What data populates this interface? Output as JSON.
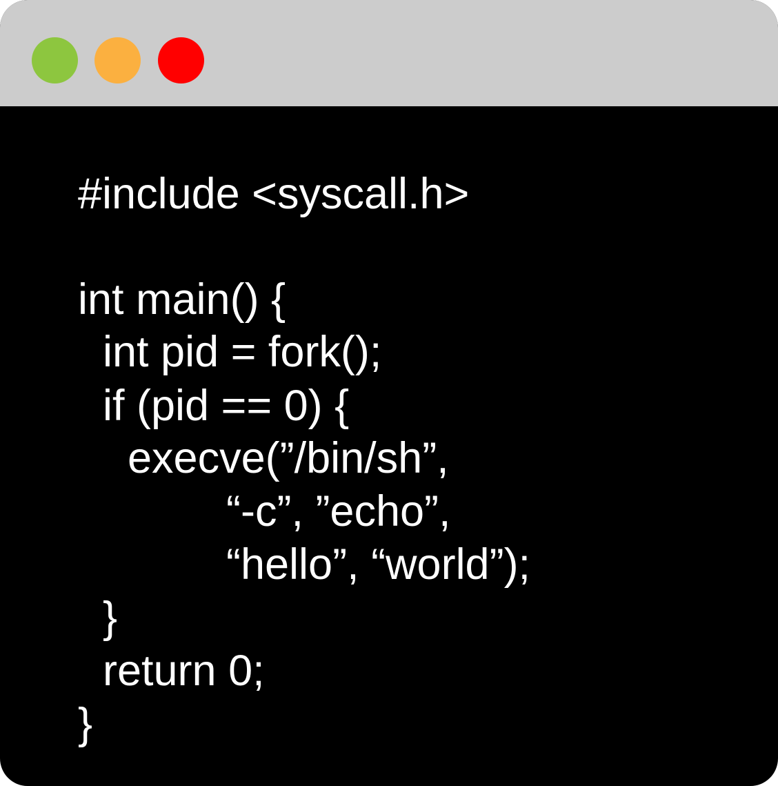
{
  "window": {
    "title_buttons": [
      {
        "name": "green",
        "color": "#8dc63f"
      },
      {
        "name": "orange",
        "color": "#fbb040"
      },
      {
        "name": "red",
        "color": "#ff0000"
      }
    ],
    "titlebar_color": "#cccccc",
    "background_color": "#000000",
    "text_color": "#ffffff"
  },
  "code": {
    "lines": [
      "#include <syscall.h>",
      "int main() {",
      "int pid = fork();",
      "if (pid == 0) {",
      "execve(”/bin/sh”,",
      "“-c”, ”echo”,",
      "“hello”, “world”);",
      "}",
      "return 0;",
      "}"
    ]
  }
}
